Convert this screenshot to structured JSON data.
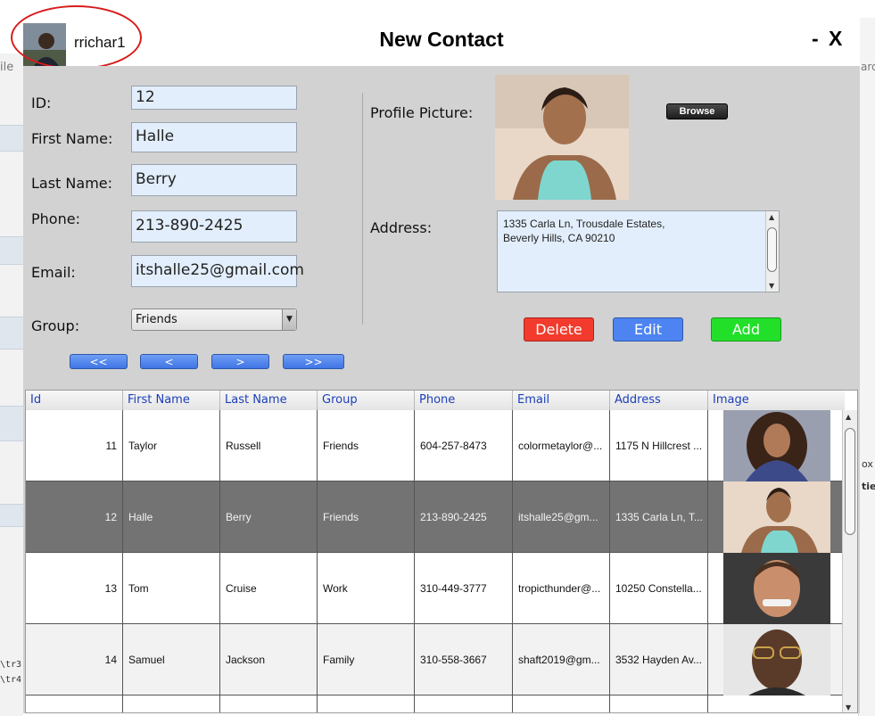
{
  "window": {
    "title": "New Contact",
    "minimize_label": "-",
    "close_label": "X",
    "username": "rrichar1"
  },
  "background_fragments": {
    "left_edge_text": "ile",
    "code_line_1": "\\tr3",
    "code_line_2": "\\tr4",
    "right_edge_1": "arc",
    "right_edge_2": "ox",
    "right_edge_3": "ties"
  },
  "form": {
    "id_label": "ID:",
    "id_value": "12",
    "first_name_label": "First Name:",
    "first_name_value": "Halle",
    "last_name_label": "Last Name:",
    "last_name_value": "Berry",
    "phone_label": "Phone:",
    "phone_value": "213-890-2425",
    "email_label": "Email:",
    "email_value": "itshalle25@gmail.com",
    "group_label": "Group:",
    "group_value": "Friends",
    "profile_picture_label": "Profile Picture:",
    "browse_label": "Browse",
    "address_label": "Address:",
    "address_line1": "1335 Carla Ln, Trousdale Estates,",
    "address_line2": "Beverly Hills, CA 90210"
  },
  "navigation": {
    "first_label": "<<",
    "prev_label": "<",
    "next_label": ">",
    "last_label": ">>"
  },
  "actions": {
    "delete_label": "Delete",
    "edit_label": "Edit",
    "add_label": "Add"
  },
  "colors": {
    "delete": "#f23b2c",
    "edit": "#4d84f2",
    "add": "#22e02a",
    "selected_row": "#737373",
    "header_text": "#1b3fb8"
  },
  "table": {
    "columns": [
      "Id",
      "First Name",
      "Last Name",
      "Group",
      "Phone",
      "Email",
      "Address",
      "Image"
    ],
    "rows": [
      {
        "id": "11",
        "first": "Taylor",
        "last": "Russell",
        "group": "Friends",
        "phone": "604-257-8473",
        "email": "colormetaylor@...",
        "address": "1175 N Hillcrest ..."
      },
      {
        "id": "12",
        "first": "Halle",
        "last": "Berry",
        "group": "Friends",
        "phone": "213-890-2425",
        "email": "itshalle25@gm...",
        "address": "1335 Carla Ln, T..."
      },
      {
        "id": "13",
        "first": "Tom",
        "last": "Cruise",
        "group": "Work",
        "phone": "310-449-3777",
        "email": "tropicthunder@...",
        "address": "10250 Constella..."
      },
      {
        "id": "14",
        "first": "Samuel",
        "last": "Jackson",
        "group": "Family",
        "phone": "310-558-3667",
        "email": "shaft2019@gm...",
        "address": "3532 Hayden Av..."
      }
    ]
  }
}
